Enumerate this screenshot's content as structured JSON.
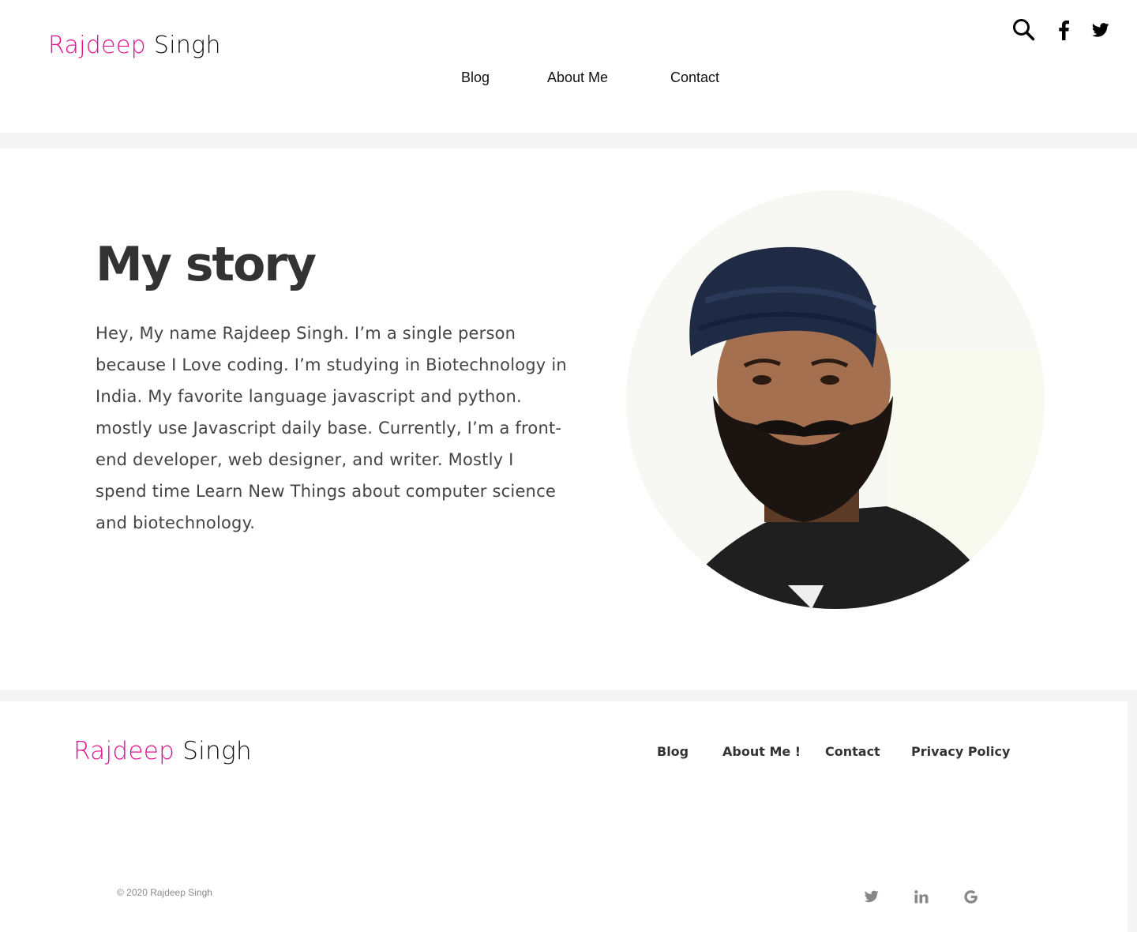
{
  "header": {
    "logo_first": "Rajdeep",
    "logo_last": "Singh",
    "nav": {
      "blog": "Blog",
      "about": "About Me",
      "contact": "Contact"
    },
    "icons": [
      "search-icon",
      "facebook-icon",
      "twitter-icon"
    ]
  },
  "story": {
    "title": "My story",
    "body": "Hey, My name Rajdeep Singh. I’m a single person because I Love coding. I’m studying in Biotechnology in India. My favorite language javascript and python. mostly use Javascript daily base. Currently, I’m a front-end developer, web designer, and writer. Mostly I spend time Learn New Things about computer science and biotechnology."
  },
  "footer": {
    "logo_first": "Rajdeep",
    "logo_last": "Singh",
    "nav": {
      "blog": "Blog",
      "about": "About Me !",
      "contact": "Contact",
      "privacy": "Privacy Policy"
    },
    "copyright": "© 2020 Rajdeep Singh",
    "social_icons": [
      "twitter-icon",
      "linkedin-icon",
      "google-icon"
    ]
  },
  "colors": {
    "brand_accent": "#e0118f",
    "text_dark": "#333333",
    "band_gray": "#f4f4f4",
    "muted": "#8a8a8a"
  }
}
